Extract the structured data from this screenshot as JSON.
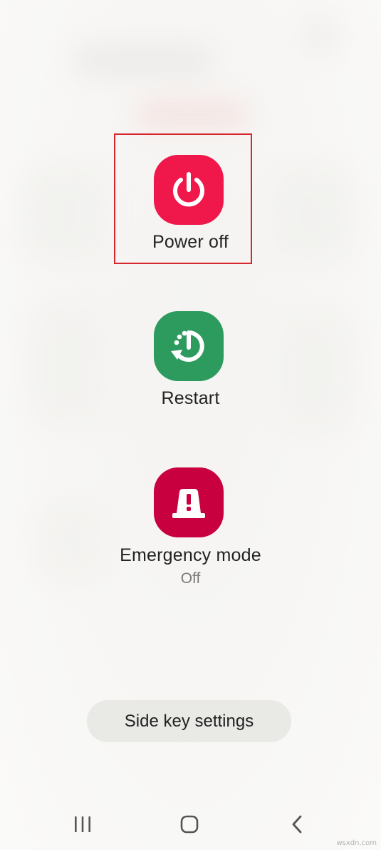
{
  "power_menu": {
    "items": [
      {
        "id": "power_off",
        "label": "Power off",
        "color": "#f0174a",
        "icon": "power-icon",
        "highlighted": true
      },
      {
        "id": "restart",
        "label": "Restart",
        "color": "#2d9a5e",
        "icon": "restart-icon"
      },
      {
        "id": "emergency",
        "label": "Emergency mode",
        "sublabel": "Off",
        "color": "#c8003f",
        "icon": "emergency-siren-icon"
      }
    ],
    "side_key_label": "Side key settings"
  },
  "nav_bar": {
    "buttons": [
      "recents-icon",
      "home-icon",
      "back-icon"
    ]
  },
  "colors": {
    "highlight_border": "#d6262e",
    "background": "#f7f6f4",
    "pill": "#e9e9e6"
  },
  "watermark": "wsxdn.com"
}
